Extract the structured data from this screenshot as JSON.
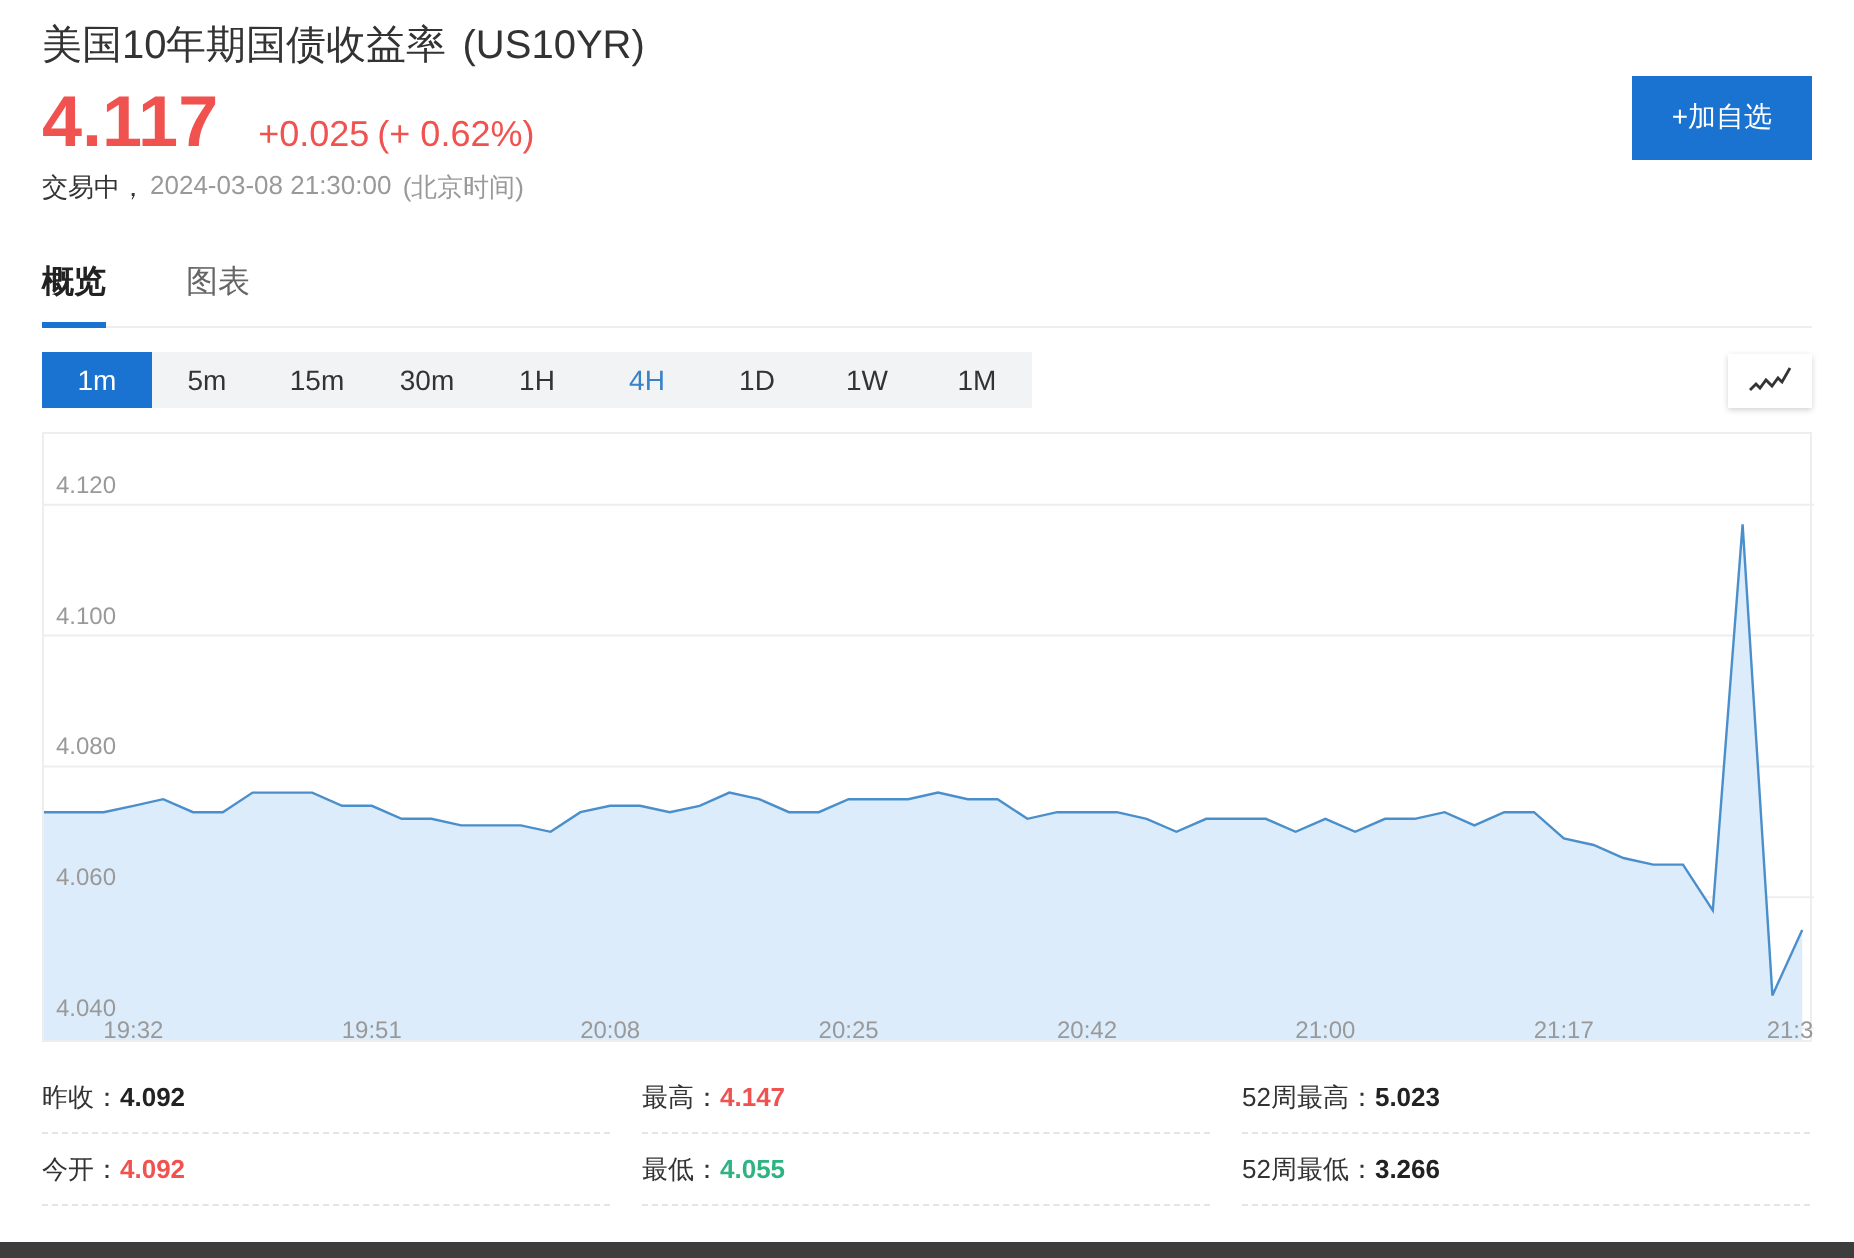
{
  "header": {
    "title": "美国10年期国债收益率",
    "symbol": "(US10YR)",
    "price": "4.117",
    "change": "+0.025",
    "change_pct": "(+ 0.62%)",
    "status": "交易中，",
    "timestamp": "2024-03-08 21:30:00",
    "timezone": "(北京时间)",
    "watch_button": "+加自选"
  },
  "tabs": [
    {
      "label": "概览",
      "selected": true
    },
    {
      "label": "图表",
      "selected": false
    }
  ],
  "periods": [
    {
      "label": "1m",
      "selected": true,
      "hover": false
    },
    {
      "label": "5m",
      "selected": false,
      "hover": false
    },
    {
      "label": "15m",
      "selected": false,
      "hover": false
    },
    {
      "label": "30m",
      "selected": false,
      "hover": false
    },
    {
      "label": "1H",
      "selected": false,
      "hover": false
    },
    {
      "label": "4H",
      "selected": false,
      "hover": true
    },
    {
      "label": "1D",
      "selected": false,
      "hover": false
    },
    {
      "label": "1W",
      "selected": false,
      "hover": false
    },
    {
      "label": "1M",
      "selected": false,
      "hover": false
    }
  ],
  "chart": {
    "chart_data": {
      "type": "area",
      "grid": true,
      "ylim": [
        4.0382,
        4.1308
      ],
      "categories": [
        null,
        null,
        null,
        "19:32",
        null,
        null,
        null,
        null,
        null,
        null,
        null,
        "19:51",
        null,
        null,
        null,
        null,
        null,
        null,
        null,
        "20:08",
        null,
        null,
        null,
        null,
        null,
        null,
        null,
        "20:25",
        null,
        null,
        null,
        null,
        null,
        null,
        null,
        "20:42",
        null,
        null,
        null,
        null,
        null,
        null,
        null,
        "21:00",
        null,
        null,
        null,
        null,
        null,
        null,
        null,
        "21:17",
        null,
        null,
        null,
        null,
        null,
        null,
        null,
        "21:3"
      ],
      "series": [
        {
          "color": "#4a8fcb",
          "values": [
            4.073,
            4.073,
            4.073,
            4.074,
            4.075,
            4.073,
            4.073,
            4.076,
            4.076,
            4.076,
            4.074,
            4.074,
            4.072,
            4.072,
            4.071,
            4.071,
            4.071,
            4.07,
            4.073,
            4.074,
            4.074,
            4.073,
            4.074,
            4.076,
            4.075,
            4.073,
            4.073,
            4.075,
            4.075,
            4.075,
            4.076,
            4.075,
            4.075,
            4.072,
            4.073,
            4.073,
            4.073,
            4.072,
            4.07,
            4.072,
            4.072,
            4.072,
            4.07,
            4.072,
            4.07,
            4.072,
            4.072,
            4.073,
            4.071,
            4.073,
            4.073,
            4.069,
            4.068,
            4.066,
            4.065,
            4.065,
            4.058,
            4.117,
            4.045,
            4.055
          ]
        }
      ],
      "yticks": [
        {
          "value": 4.04,
          "label": "4.040"
        },
        {
          "value": 4.06,
          "label": "4.060"
        },
        {
          "value": 4.08,
          "label": "4.080"
        },
        {
          "value": 4.1,
          "label": "4.100"
        },
        {
          "value": 4.12,
          "label": "4.120"
        }
      ]
    }
  },
  "stats": [
    {
      "label": "昨收：",
      "value": "4.092",
      "color": "#222222"
    },
    {
      "label": "最高：",
      "value": "4.147",
      "color": "#f0524f"
    },
    {
      "label": "52周最高：",
      "value": "5.023",
      "color": "#222222"
    },
    {
      "label": "今开：",
      "value": "4.092",
      "color": "#f0524f"
    },
    {
      "label": "最低：",
      "value": "4.055",
      "color": "#2fb383"
    },
    {
      "label": "52周最低：",
      "value": "3.266",
      "color": "#222222"
    }
  ]
}
